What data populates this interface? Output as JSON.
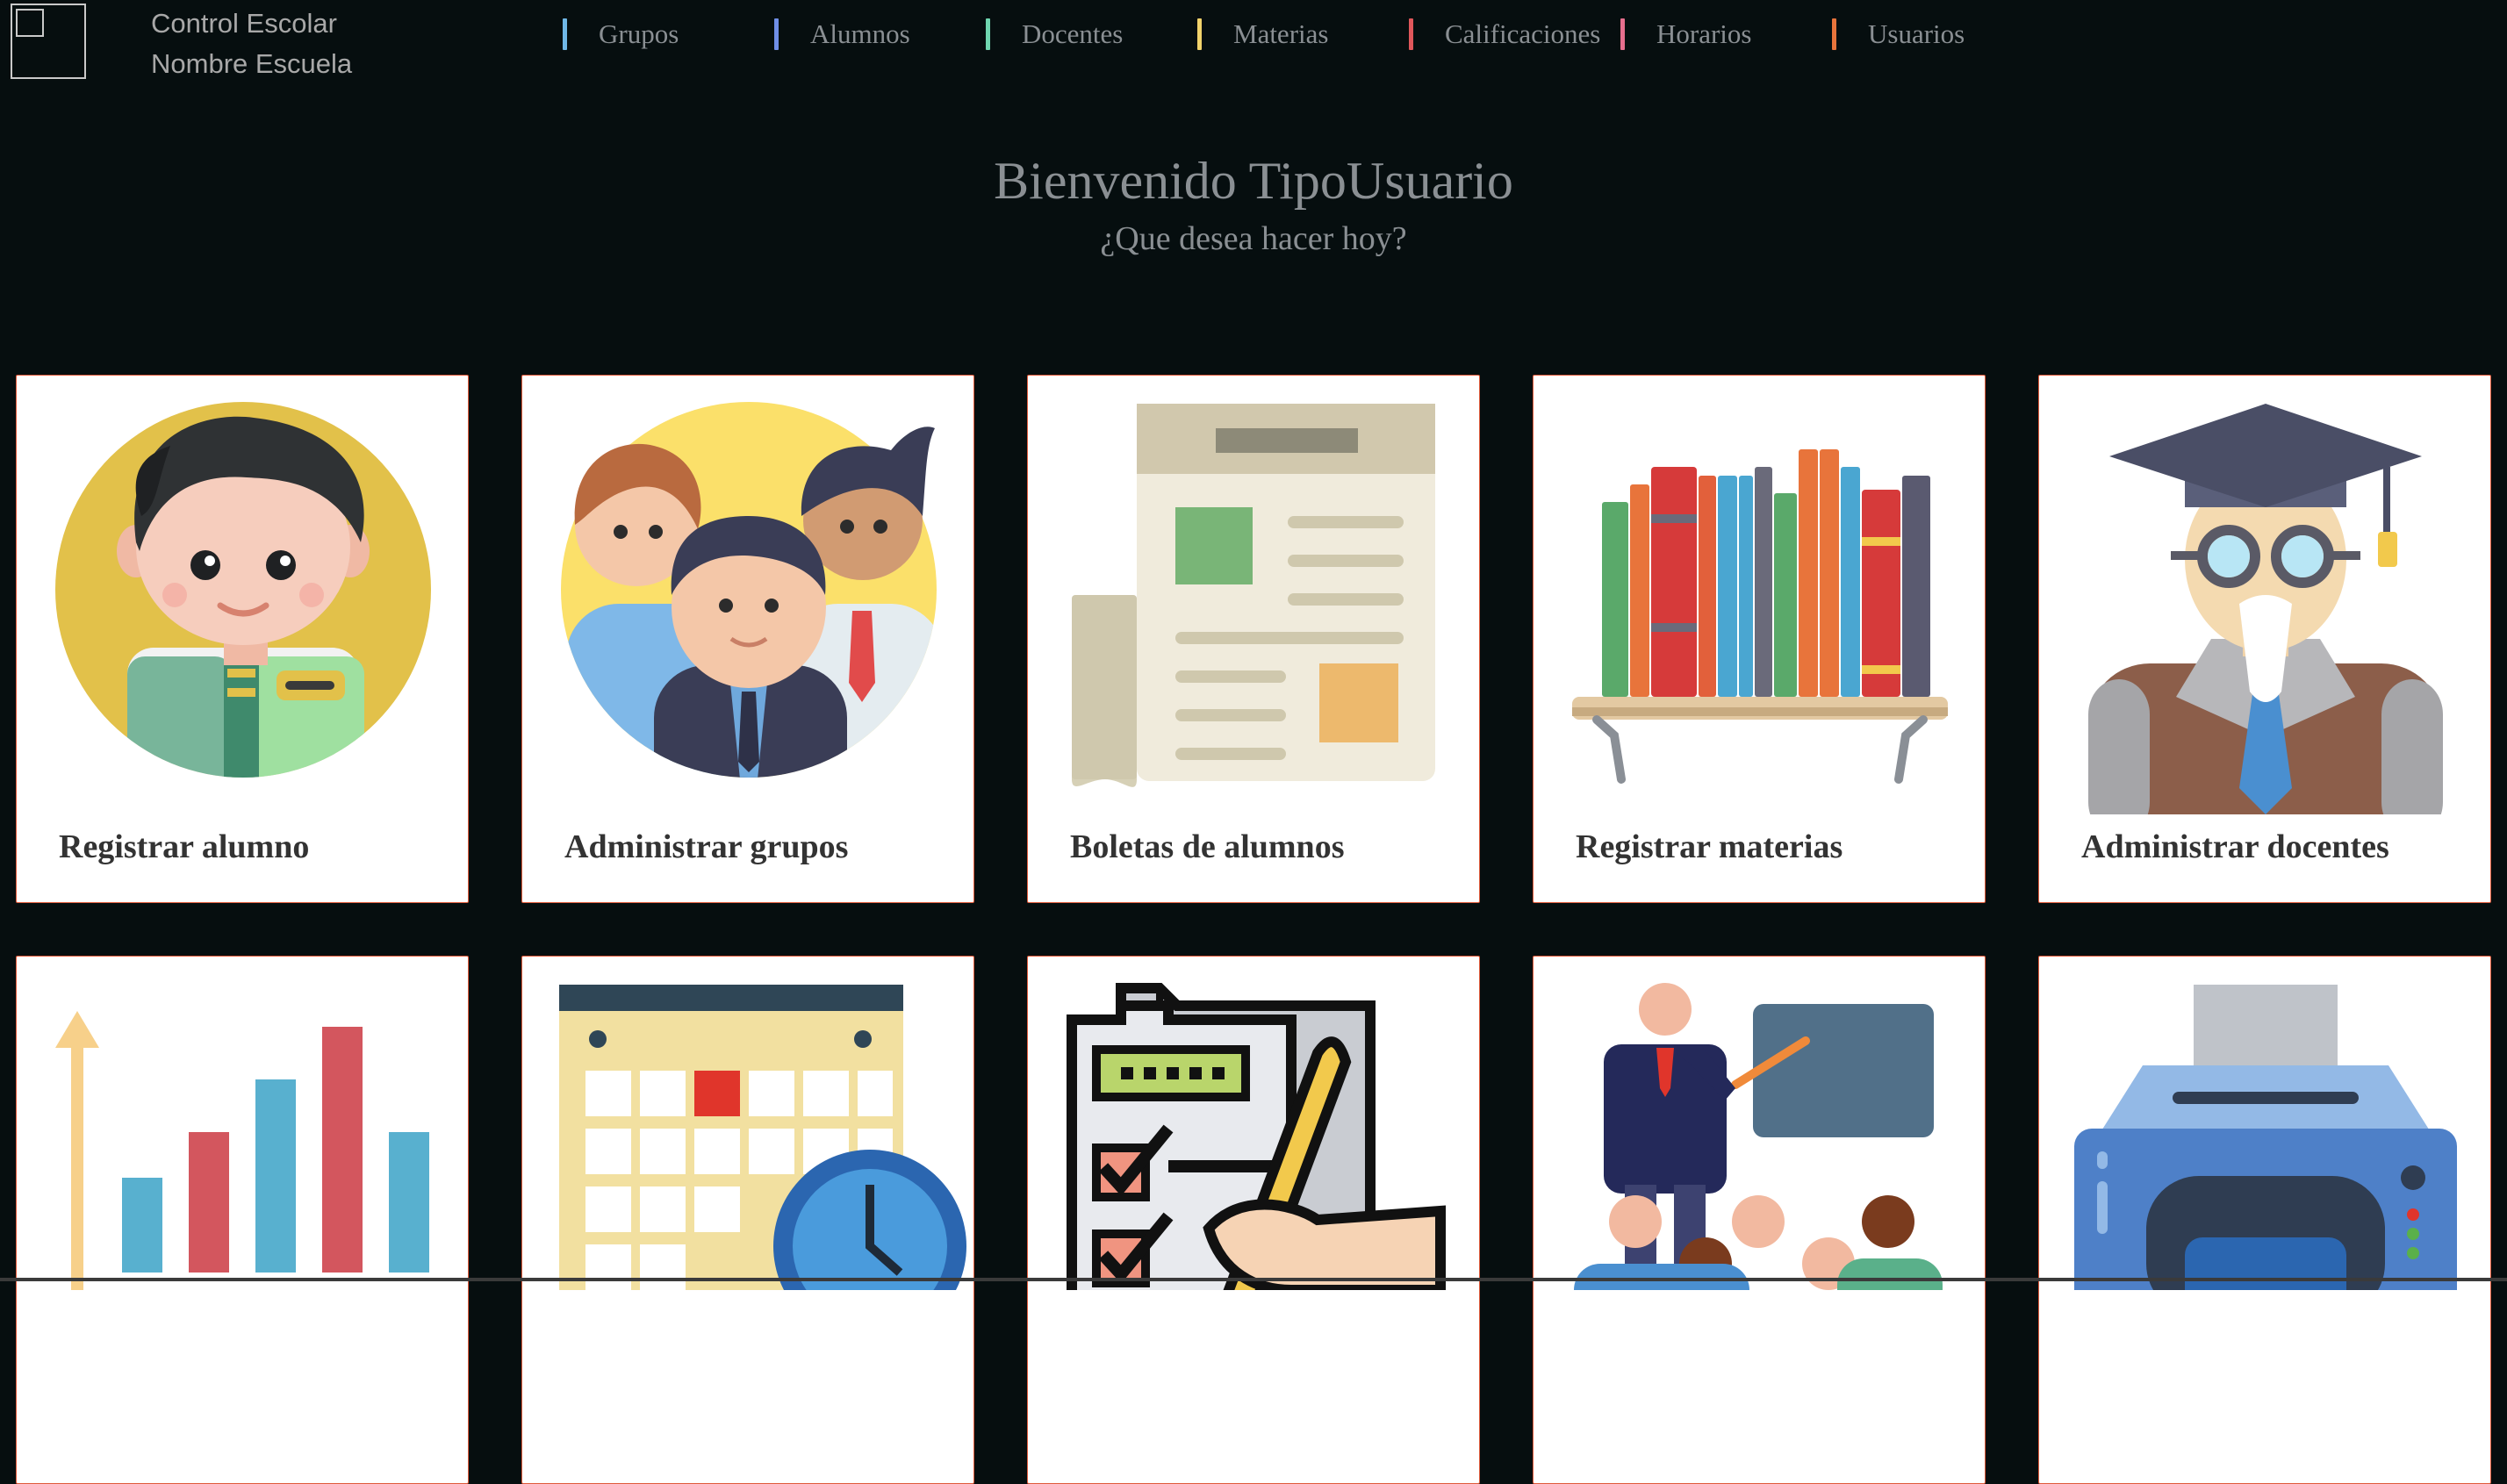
{
  "brand": {
    "line1": "Control Escolar",
    "line2": "Nombre Escuela"
  },
  "nav": [
    {
      "label": "Grupos",
      "color": "#6fb7e6"
    },
    {
      "label": "Alumnos",
      "color": "#6f8ee6"
    },
    {
      "label": "Docentes",
      "color": "#6fd6b0"
    },
    {
      "label": "Materias",
      "color": "#f2d36b"
    },
    {
      "label": "Calificaciones",
      "color": "#e0575b"
    },
    {
      "label": "Horarios",
      "color": "#e66f8e"
    },
    {
      "label": "Usuarios",
      "color": "#e8743b"
    }
  ],
  "welcome": {
    "title": "Bienvenido TipoUsuario",
    "subtitle": "¿Que desea hacer hoy?"
  },
  "cards": [
    {
      "label": "Registrar alumno",
      "icon": "student-icon"
    },
    {
      "label": "Administrar grupos",
      "icon": "group-icon"
    },
    {
      "label": "Boletas de alumnos",
      "icon": "newspaper-icon"
    },
    {
      "label": "Registrar materias",
      "icon": "bookshelf-icon"
    },
    {
      "label": "Administrar docentes",
      "icon": "professor-icon"
    },
    {
      "label": "",
      "icon": "bar-chart-icon"
    },
    {
      "label": "",
      "icon": "calendar-icon"
    },
    {
      "label": "",
      "icon": "checklist-icon"
    },
    {
      "label": "",
      "icon": "teacher-class-icon"
    },
    {
      "label": "",
      "icon": "printer-icon"
    }
  ]
}
